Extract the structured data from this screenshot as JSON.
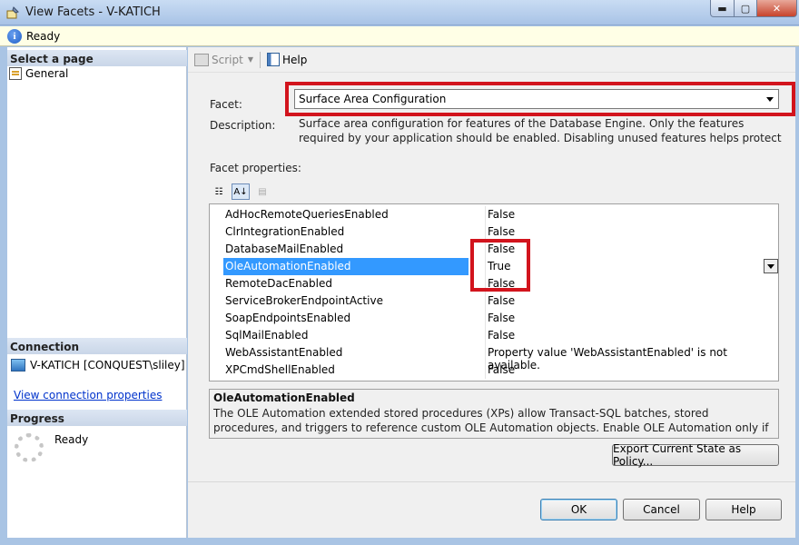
{
  "window": {
    "title": "View Facets - V-KATICH",
    "min_glyph": "▬",
    "max_glyph": "▢",
    "close_glyph": "✕"
  },
  "status": {
    "icon": "info-icon",
    "text": "Ready"
  },
  "left_panel": {
    "select_page_header": "Select a page",
    "pages": [
      {
        "label": "General",
        "icon": "general-page-icon"
      }
    ],
    "connection_header": "Connection",
    "connection": "V-KATICH [CONQUEST\\sliley]",
    "connection_link": "View connection properties",
    "progress_header": "Progress",
    "progress_status": "Ready"
  },
  "toolbar": {
    "script_label": "Script",
    "help_label": "Help"
  },
  "facet": {
    "label": "Facet:",
    "selected": "Surface Area Configuration",
    "description_label": "Description:",
    "description": "Surface area configuration for features of the Database Engine. Only the features required by your application should be enabled. Disabling unused features helps protect your server by reducing the",
    "properties_label": "Facet properties:"
  },
  "properties": [
    {
      "name": "AdHocRemoteQueriesEnabled",
      "value": "False"
    },
    {
      "name": "ClrIntegrationEnabled",
      "value": "False"
    },
    {
      "name": "DatabaseMailEnabled",
      "value": "False"
    },
    {
      "name": "OleAutomationEnabled",
      "value": "True"
    },
    {
      "name": "RemoteDacEnabled",
      "value": "False"
    },
    {
      "name": "ServiceBrokerEndpointActive",
      "value": "False"
    },
    {
      "name": "SoapEndpointsEnabled",
      "value": "False"
    },
    {
      "name": "SqlMailEnabled",
      "value": "False"
    },
    {
      "name": "WebAssistantEnabled",
      "value": "Property value 'WebAssistantEnabled' is not available."
    },
    {
      "name": "XPCmdShellEnabled",
      "value": "False"
    }
  ],
  "selected_property": {
    "title": "OleAutomationEnabled",
    "body": "The OLE Automation extended stored procedures (XPs) allow Transact-SQL batches, stored procedures, and triggers to reference custom OLE Automation objects. Enable OLE Automation only if applications or Transact-SQL scripts u..."
  },
  "buttons": {
    "export": "Export Current State as Policy...",
    "ok": "OK",
    "cancel": "Cancel",
    "help": "Help"
  },
  "colors": {
    "highlight_border": "#d2141d",
    "selection": "#3399ff",
    "info_bar": "#ffffe6"
  }
}
